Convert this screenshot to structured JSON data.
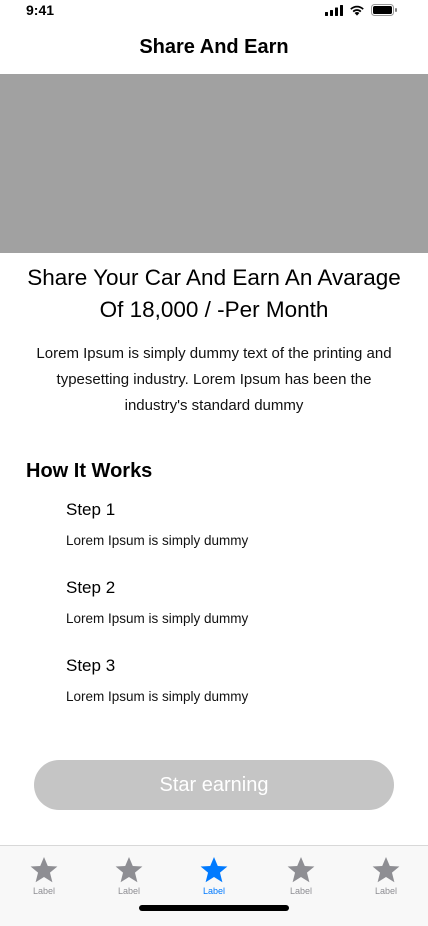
{
  "status_bar": {
    "time": "9:41",
    "icons": [
      "signal-icon",
      "wifi-icon",
      "battery-icon"
    ]
  },
  "header": {
    "title": "Share And Earn"
  },
  "hero": {
    "image_color": "#a1a1a1"
  },
  "main": {
    "headline": "Share Your Car And Earn An Avarage Of 18,000 / -Per Month",
    "intro": "Lorem Ipsum is simply dummy text of the printing and typesetting industry. Lorem Ipsum has been the industry's standard dummy",
    "how_title": "How It Works",
    "steps": [
      {
        "title": "Step 1",
        "desc": "Lorem Ipsum is simply dummy"
      },
      {
        "title": "Step 2",
        "desc": "Lorem Ipsum is simply dummy"
      },
      {
        "title": "Step 3",
        "desc": "Lorem Ipsum is simply dummy"
      }
    ]
  },
  "cta": {
    "label": "Star earning",
    "color": "#c5c5c5"
  },
  "tab_bar": {
    "active_index": 2,
    "active_color": "#007aff",
    "inactive_color": "#8e8e93",
    "items": [
      {
        "label": "Label",
        "icon": "star-icon"
      },
      {
        "label": "Label",
        "icon": "star-icon"
      },
      {
        "label": "Label",
        "icon": "star-icon"
      },
      {
        "label": "Label",
        "icon": "star-icon"
      },
      {
        "label": "Label",
        "icon": "star-icon"
      }
    ]
  }
}
